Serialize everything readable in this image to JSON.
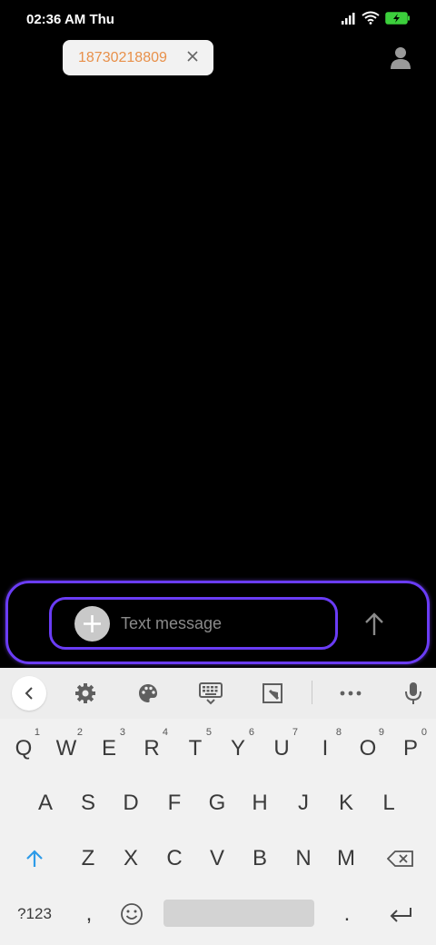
{
  "status_bar": {
    "time": "02:36 AM Thu",
    "icons": [
      "signal-icon",
      "wifi-icon",
      "battery-charging-icon"
    ],
    "battery_color": "#3ccf3c"
  },
  "recipient": {
    "number": "18730218809",
    "color": "#e8904a"
  },
  "compose": {
    "placeholder": "Text message",
    "accent_color": "#6a3cf5"
  },
  "keyboard": {
    "toolbar_icons": [
      "back-icon",
      "gear-icon",
      "palette-icon",
      "keyboard-icon",
      "resize-icon",
      "more-icon",
      "mic-icon"
    ],
    "row1": [
      {
        "label": "Q",
        "hint": "1"
      },
      {
        "label": "W",
        "hint": "2"
      },
      {
        "label": "E",
        "hint": "3"
      },
      {
        "label": "R",
        "hint": "4"
      },
      {
        "label": "T",
        "hint": "5"
      },
      {
        "label": "Y",
        "hint": "6"
      },
      {
        "label": "U",
        "hint": "7"
      },
      {
        "label": "I",
        "hint": "8"
      },
      {
        "label": "O",
        "hint": "9"
      },
      {
        "label": "P",
        "hint": "0"
      }
    ],
    "row2": [
      "A",
      "S",
      "D",
      "F",
      "G",
      "H",
      "J",
      "K",
      "L"
    ],
    "row3": [
      "Z",
      "X",
      "C",
      "V",
      "B",
      "N",
      "M"
    ],
    "symbols_label": "?123",
    "comma_label": ",",
    "period_label": ".",
    "shift_color": "#2d9be8"
  }
}
